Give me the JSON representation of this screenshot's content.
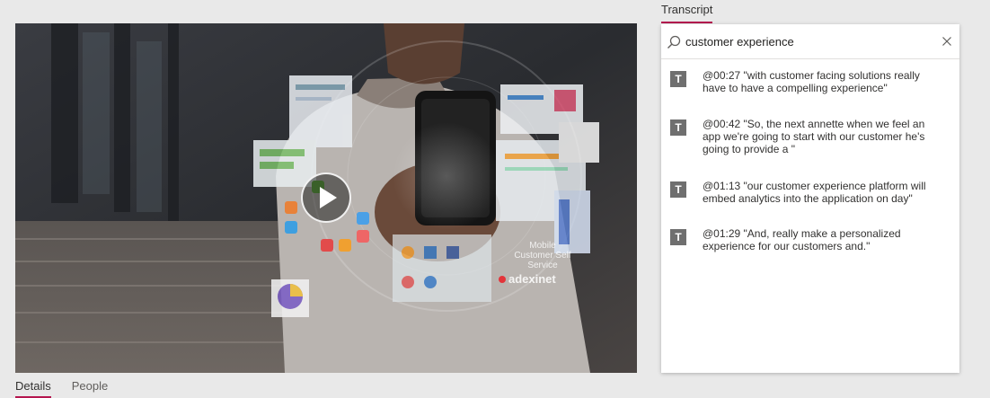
{
  "transcript": {
    "title": "Transcript",
    "search_value": "customer experience",
    "results": [
      {
        "text": "@00:27 \"with customer facing solutions really have to have a compelling experience\""
      },
      {
        "text": "@00:42 \"So, the next annette when we feel an app we're going to start with our customer he's going to provide a \""
      },
      {
        "text": "@01:13 \"our customer experience platform will embed analytics into the application on day\""
      },
      {
        "text": "@01:29 \"And, really make a personalized experience for our customers and.\""
      }
    ],
    "result_icon_letter": "T"
  },
  "video": {
    "overlay_text": "Mobile Customer Self Service",
    "brand": "adexinet"
  },
  "tabs": [
    {
      "label": "Details",
      "active": true
    },
    {
      "label": "People",
      "active": false
    }
  ],
  "colors": {
    "accent": "#b5164e",
    "panel_bg": "#ffffff",
    "page_bg": "#e9e9e9"
  },
  "icons": {
    "search": "search-icon",
    "close": "close-icon",
    "play": "play-icon",
    "transcript_item": "text-t-icon"
  }
}
